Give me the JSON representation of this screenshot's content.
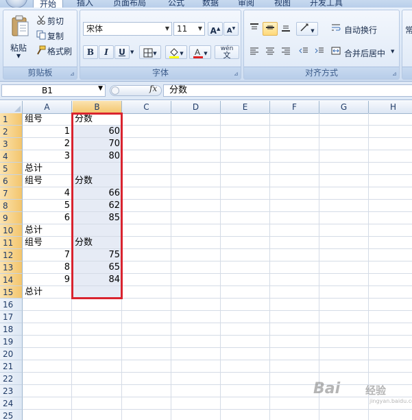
{
  "tabs": [
    "开始",
    "插入",
    "页面布局",
    "公式",
    "数据",
    "审阅",
    "视图",
    "开发工具"
  ],
  "ribbon": {
    "clipboard": {
      "label": "剪贴板",
      "paste": "粘贴",
      "cut": "剪切",
      "copy": "复制",
      "format_painter": "格式刷"
    },
    "font": {
      "label": "字体",
      "font_name": "宋体",
      "font_size": "11",
      "bold": "B",
      "italic": "I",
      "underline": "U",
      "grow": "A",
      "shrink": "A",
      "phonetic": "wén",
      "phonetic_char": "文"
    },
    "alignment": {
      "label": "对齐方式",
      "wrap_text": "自动换行",
      "merge_center": "合并后居中"
    },
    "number": {
      "partial": "常"
    }
  },
  "formula_bar": {
    "name_box": "B1",
    "fx": "fx",
    "content": "分数"
  },
  "columns": [
    "A",
    "B",
    "C",
    "D",
    "E",
    "F",
    "G",
    "H"
  ],
  "rows": [
    "1",
    "2",
    "3",
    "4",
    "5",
    "6",
    "7",
    "8",
    "9",
    "10",
    "11",
    "12",
    "13",
    "14",
    "15",
    "16",
    "17",
    "18",
    "19",
    "20",
    "21",
    "22",
    "23",
    "24",
    "25"
  ],
  "cells": {
    "A": [
      "组号",
      "1",
      "2",
      "3",
      "总计",
      "组号",
      "4",
      "5",
      "6",
      "总计",
      "组号",
      "7",
      "8",
      "9",
      "总计"
    ],
    "B": [
      "分数",
      "60",
      "70",
      "80",
      "",
      "分数",
      "66",
      "62",
      "85",
      "",
      "分数",
      "75",
      "65",
      "84",
      ""
    ]
  },
  "watermark": {
    "brand": "Bai",
    "suffix": "经验",
    "url": "jingyan.baidu.com"
  }
}
